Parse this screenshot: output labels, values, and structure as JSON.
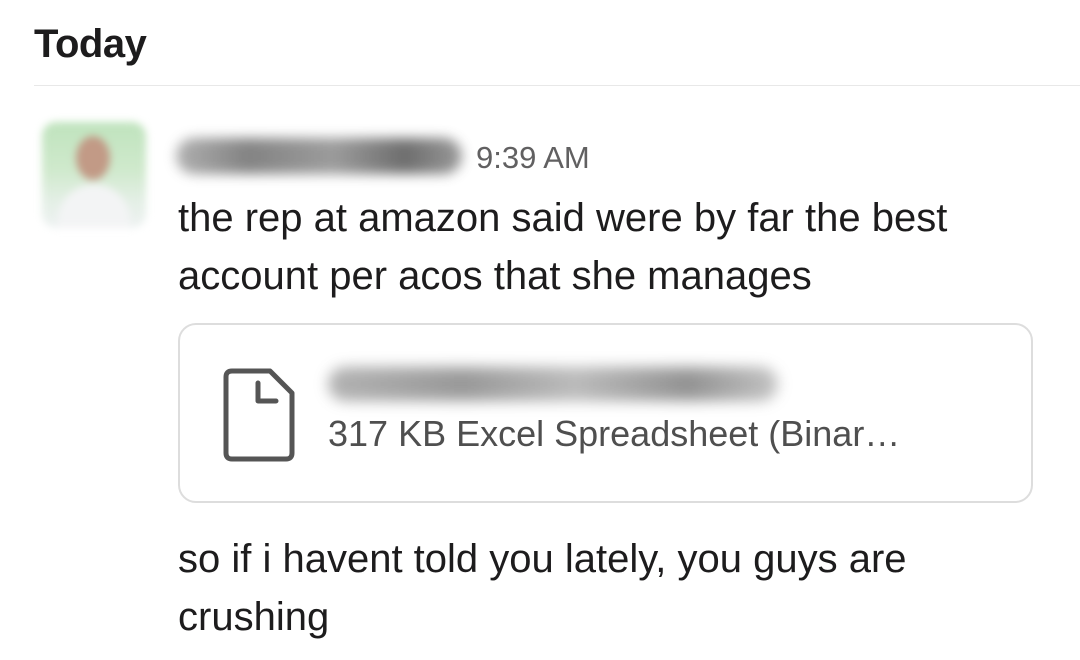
{
  "channel": {
    "day_header": "Today"
  },
  "message": {
    "timestamp": "9:39 AM",
    "text_1": "the rep at amazon said were by far the best account per acos that she manages",
    "attachment": {
      "icon": "document-icon",
      "meta": "317 KB Excel Spreadsheet (Binar…"
    },
    "text_2": "so if i havent told you lately, you guys are crushing"
  },
  "colors": {
    "text": "#1d1c1d",
    "timestamp": "#616061",
    "card_border": "#dddddd",
    "divider": "#e8e8e8"
  }
}
